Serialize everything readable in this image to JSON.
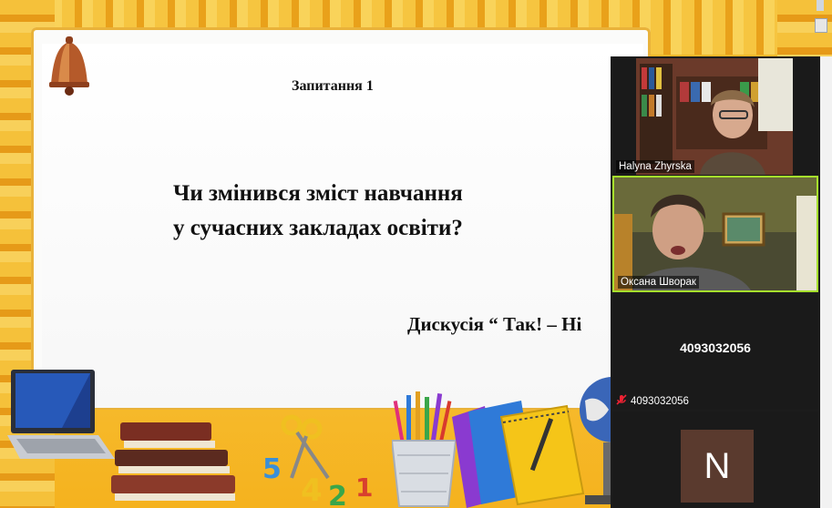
{
  "slide": {
    "title": "Запитання 1",
    "question_line1": "Чи змінився зміст навчання",
    "question_line2": "у сучасних закладах освіти?",
    "discussion": "Дискусія “ Так! – Ні"
  },
  "gallery": {
    "participants": [
      {
        "name": "Halyna Zhyrska"
      },
      {
        "name": "Оксана Шворак",
        "active_speaker": true
      },
      {
        "name": "4093032056",
        "center_label": "4093032056",
        "muted": true
      },
      {
        "avatar_letter": "N"
      }
    ]
  },
  "colors": {
    "active_border": "#a6e02c",
    "gallery_bg": "#1c1c1c",
    "avatar_bg": "#5a3a2e",
    "slide_frame": "#f3b21f"
  }
}
